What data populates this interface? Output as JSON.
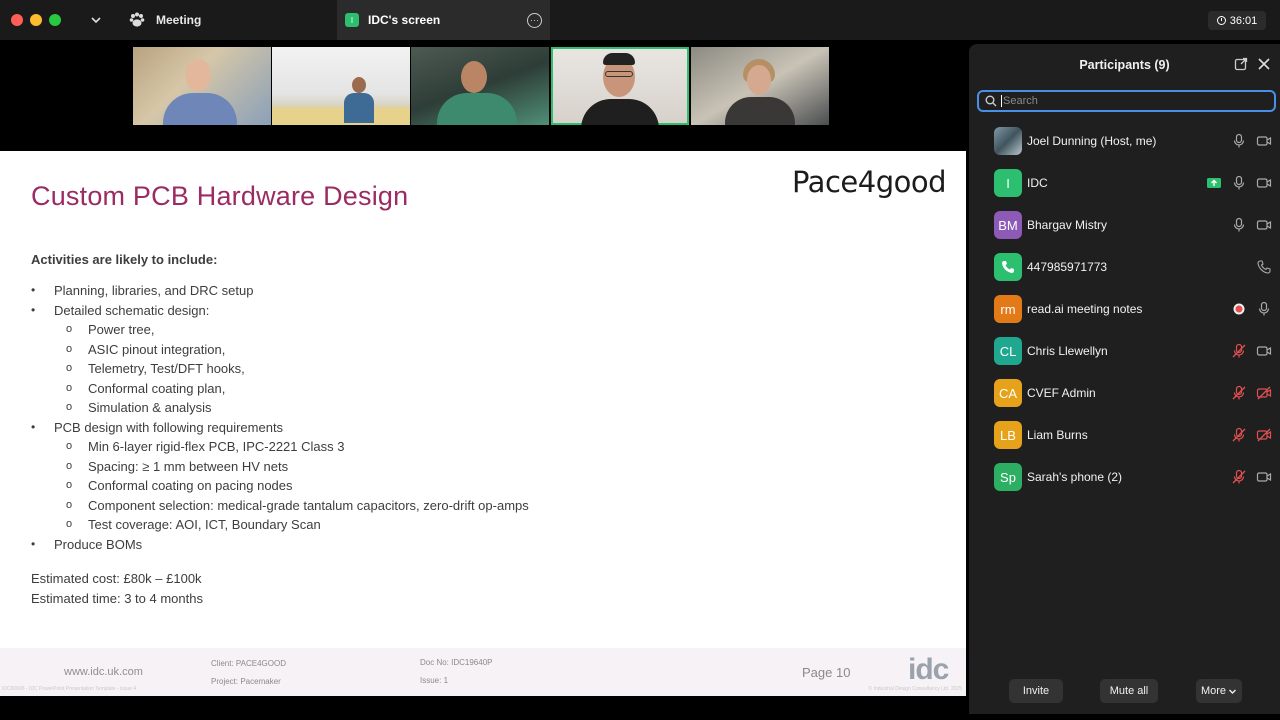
{
  "titlebar": {
    "meeting_tab": "Meeting",
    "screen_tab": "IDC's screen",
    "screen_tab_badge": "I",
    "timer": "36:01"
  },
  "slide": {
    "title": "Custom PCB Hardware Design",
    "brand": "Pace4good",
    "intro": "Activities are likely to include:",
    "bullets": [
      {
        "level": 1,
        "marker": "•",
        "text": "Planning, libraries, and DRC setup"
      },
      {
        "level": 1,
        "marker": "•",
        "text": "Detailed schematic design:"
      },
      {
        "level": 2,
        "marker": "o",
        "text": "Power tree,"
      },
      {
        "level": 2,
        "marker": "o",
        "text": "ASIC pinout integration,"
      },
      {
        "level": 2,
        "marker": "o",
        "text": "Telemetry, Test/DFT hooks,"
      },
      {
        "level": 2,
        "marker": "o",
        "text": "Conformal coating plan,"
      },
      {
        "level": 2,
        "marker": "o",
        "text": "Simulation & analysis"
      },
      {
        "level": 1,
        "marker": "•",
        "text": "PCB design with following requirements"
      },
      {
        "level": 2,
        "marker": "o",
        "text": "Min 6-layer rigid-flex PCB, IPC-2221 Class 3"
      },
      {
        "level": 2,
        "marker": "o",
        "text": "Spacing: ≥ 1 mm between HV nets"
      },
      {
        "level": 2,
        "marker": "o",
        "text": "Conformal coating on pacing nodes"
      },
      {
        "level": 2,
        "marker": "o",
        "text": "Component selection: medical-grade tantalum capacitors, zero-drift op-amps"
      },
      {
        "level": 2,
        "marker": "o",
        "text": "Test coverage: AOI, ICT, Boundary Scan"
      },
      {
        "level": 1,
        "marker": "•",
        "text": "Produce BOMs"
      }
    ],
    "estimated_cost": "Estimated cost: £80k – £100k",
    "estimated_time": "Estimated time: 3 to 4 months",
    "footer": {
      "url": "www.idc.uk.com",
      "client": "Client: PACE4GOOD",
      "project": "Project: Pacemaker",
      "doc_no": "Doc No: IDC19640P",
      "issue": "Issue: 1",
      "page": "Page 10",
      "logo": "idc",
      "tiny_left": "IDC00606 - IDC PowerPoint Presentation Template - Issue 4",
      "tiny_right": "© Industrial Design Consultancy Ltd. 2025"
    }
  },
  "participants": {
    "title": "Participants (9)",
    "search_placeholder": "Search",
    "list": [
      {
        "name": "Joel Dunning (Host, me)",
        "initials": "",
        "avatar_color": "#5b7a8a",
        "photo": true,
        "icons": [
          "mic",
          "cam"
        ],
        "mic_muted": false,
        "cam_off": false
      },
      {
        "name": "IDC",
        "initials": "I",
        "avatar_color": "#2cbf6f",
        "icons": [
          "share",
          "mic",
          "cam"
        ],
        "mic_muted": false,
        "cam_off": false
      },
      {
        "name": "Bhargav Mistry",
        "initials": "BM",
        "avatar_color": "#8e5ab8",
        "icons": [
          "mic",
          "cam"
        ],
        "mic_muted": false,
        "cam_off": false
      },
      {
        "name": "447985971773",
        "initials": "",
        "avatar_color": "#2cbf6f",
        "phone": true,
        "icons": [
          "phone"
        ]
      },
      {
        "name": "read.ai meeting notes",
        "initials": "rm",
        "avatar_color": "#e27a18",
        "icons": [
          "rec",
          "mic"
        ],
        "mic_muted": false
      },
      {
        "name": "Chris Llewellyn",
        "initials": "CL",
        "avatar_color": "#1fa88f",
        "icons": [
          "mic",
          "cam"
        ],
        "mic_muted": true,
        "cam_off": false
      },
      {
        "name": "CVEF Admin",
        "initials": "CA",
        "avatar_color": "#e5a21a",
        "icons": [
          "mic",
          "cam"
        ],
        "mic_muted": true,
        "cam_off": true
      },
      {
        "name": "Liam Burns",
        "initials": "LB",
        "avatar_color": "#e5a21a",
        "icons": [
          "mic",
          "cam"
        ],
        "mic_muted": true,
        "cam_off": true
      },
      {
        "name": "Sarah's phone (2)",
        "initials": "Sp",
        "avatar_color": "#2cae63",
        "icons": [
          "mic",
          "cam"
        ],
        "mic_muted": true,
        "cam_off": false
      }
    ],
    "footer": {
      "invite": "Invite",
      "mute_all": "Mute all",
      "more": "More"
    }
  }
}
